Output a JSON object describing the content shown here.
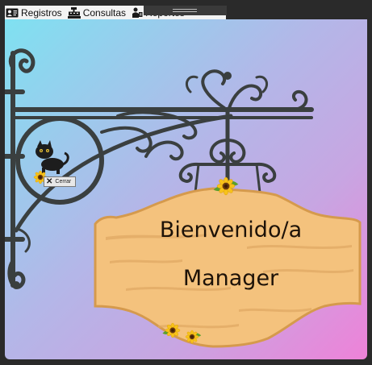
{
  "menu": {
    "registros": "Registros",
    "consultas": "Consultas",
    "reportes": "Reportes"
  },
  "sign": {
    "line1": "Bienvenido/a",
    "line2": "Manager"
  },
  "close_button": {
    "label": "Cerrar"
  },
  "icons": [
    "contact-card-icon",
    "cash-register-icon",
    "report-person-icon",
    "close-icon",
    "sunflower-icon",
    "black-cat-icon"
  ],
  "colors": {
    "gradient_start": "#7fe1f1",
    "gradient_end": "#ee82d8",
    "iron": "#3a3f3f",
    "wood": "#f4c27d",
    "wood_edge": "#d59a4d"
  }
}
